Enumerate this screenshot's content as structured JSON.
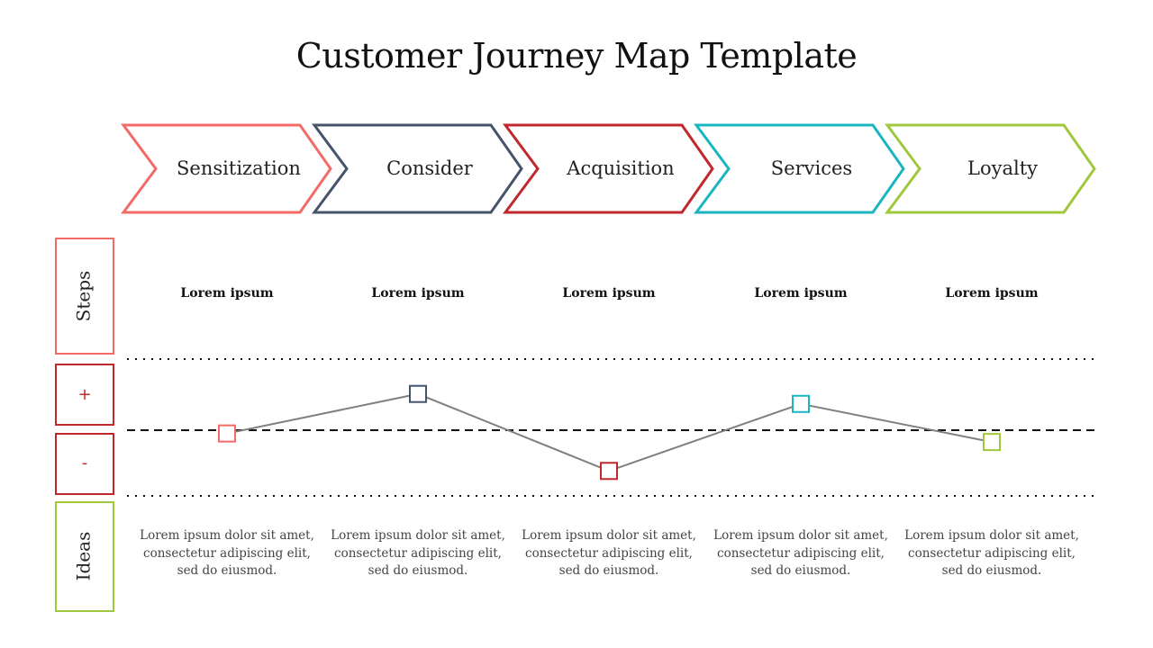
{
  "title": "Customer Journey Map Template",
  "stages": [
    {
      "label": "Sensitization",
      "color": "#f26b67"
    },
    {
      "label": "Consider",
      "color": "#44546a"
    },
    {
      "label": "Acquisition",
      "color": "#c0282d"
    },
    {
      "label": "Services",
      "color": "#19b6c0"
    },
    {
      "label": "Loyalty",
      "color": "#9fc93c"
    }
  ],
  "rows": {
    "steps": {
      "label": "Steps",
      "color": "#f26b67"
    },
    "plus": {
      "label": "+",
      "color": "#c0282d"
    },
    "minus": {
      "label": "-",
      "color": "#c0282d"
    },
    "ideas": {
      "label": "Ideas",
      "color": "#9fc93c"
    }
  },
  "steps": [
    "Lorem ipsum",
    "Lorem ipsum",
    "Lorem ipsum",
    "Lorem ipsum",
    "Lorem ipsum"
  ],
  "ideas": [
    "Lorem ipsum dolor sit amet, consectetur adipiscing elit, sed do eiusmod.",
    "Lorem ipsum dolor sit amet, consectetur adipiscing elit, sed do eiusmod.",
    "Lorem ipsum dolor sit amet, consectetur adipiscing elit, sed do eiusmod.",
    "Lorem ipsum dolor sit amet, consectetur adipiscing elit, sed do eiusmod.",
    "Lorem ipsum dolor sit amet, consectetur adipiscing elit, sed do eiusmod."
  ],
  "sentiment": {
    "scale_note": "relative to neutral baseline; +1 = top dotted line, -1 = bottom dotted line",
    "values": [
      -0.05,
      0.51,
      -0.62,
      0.37,
      -0.18
    ],
    "line_color": "#808080"
  }
}
